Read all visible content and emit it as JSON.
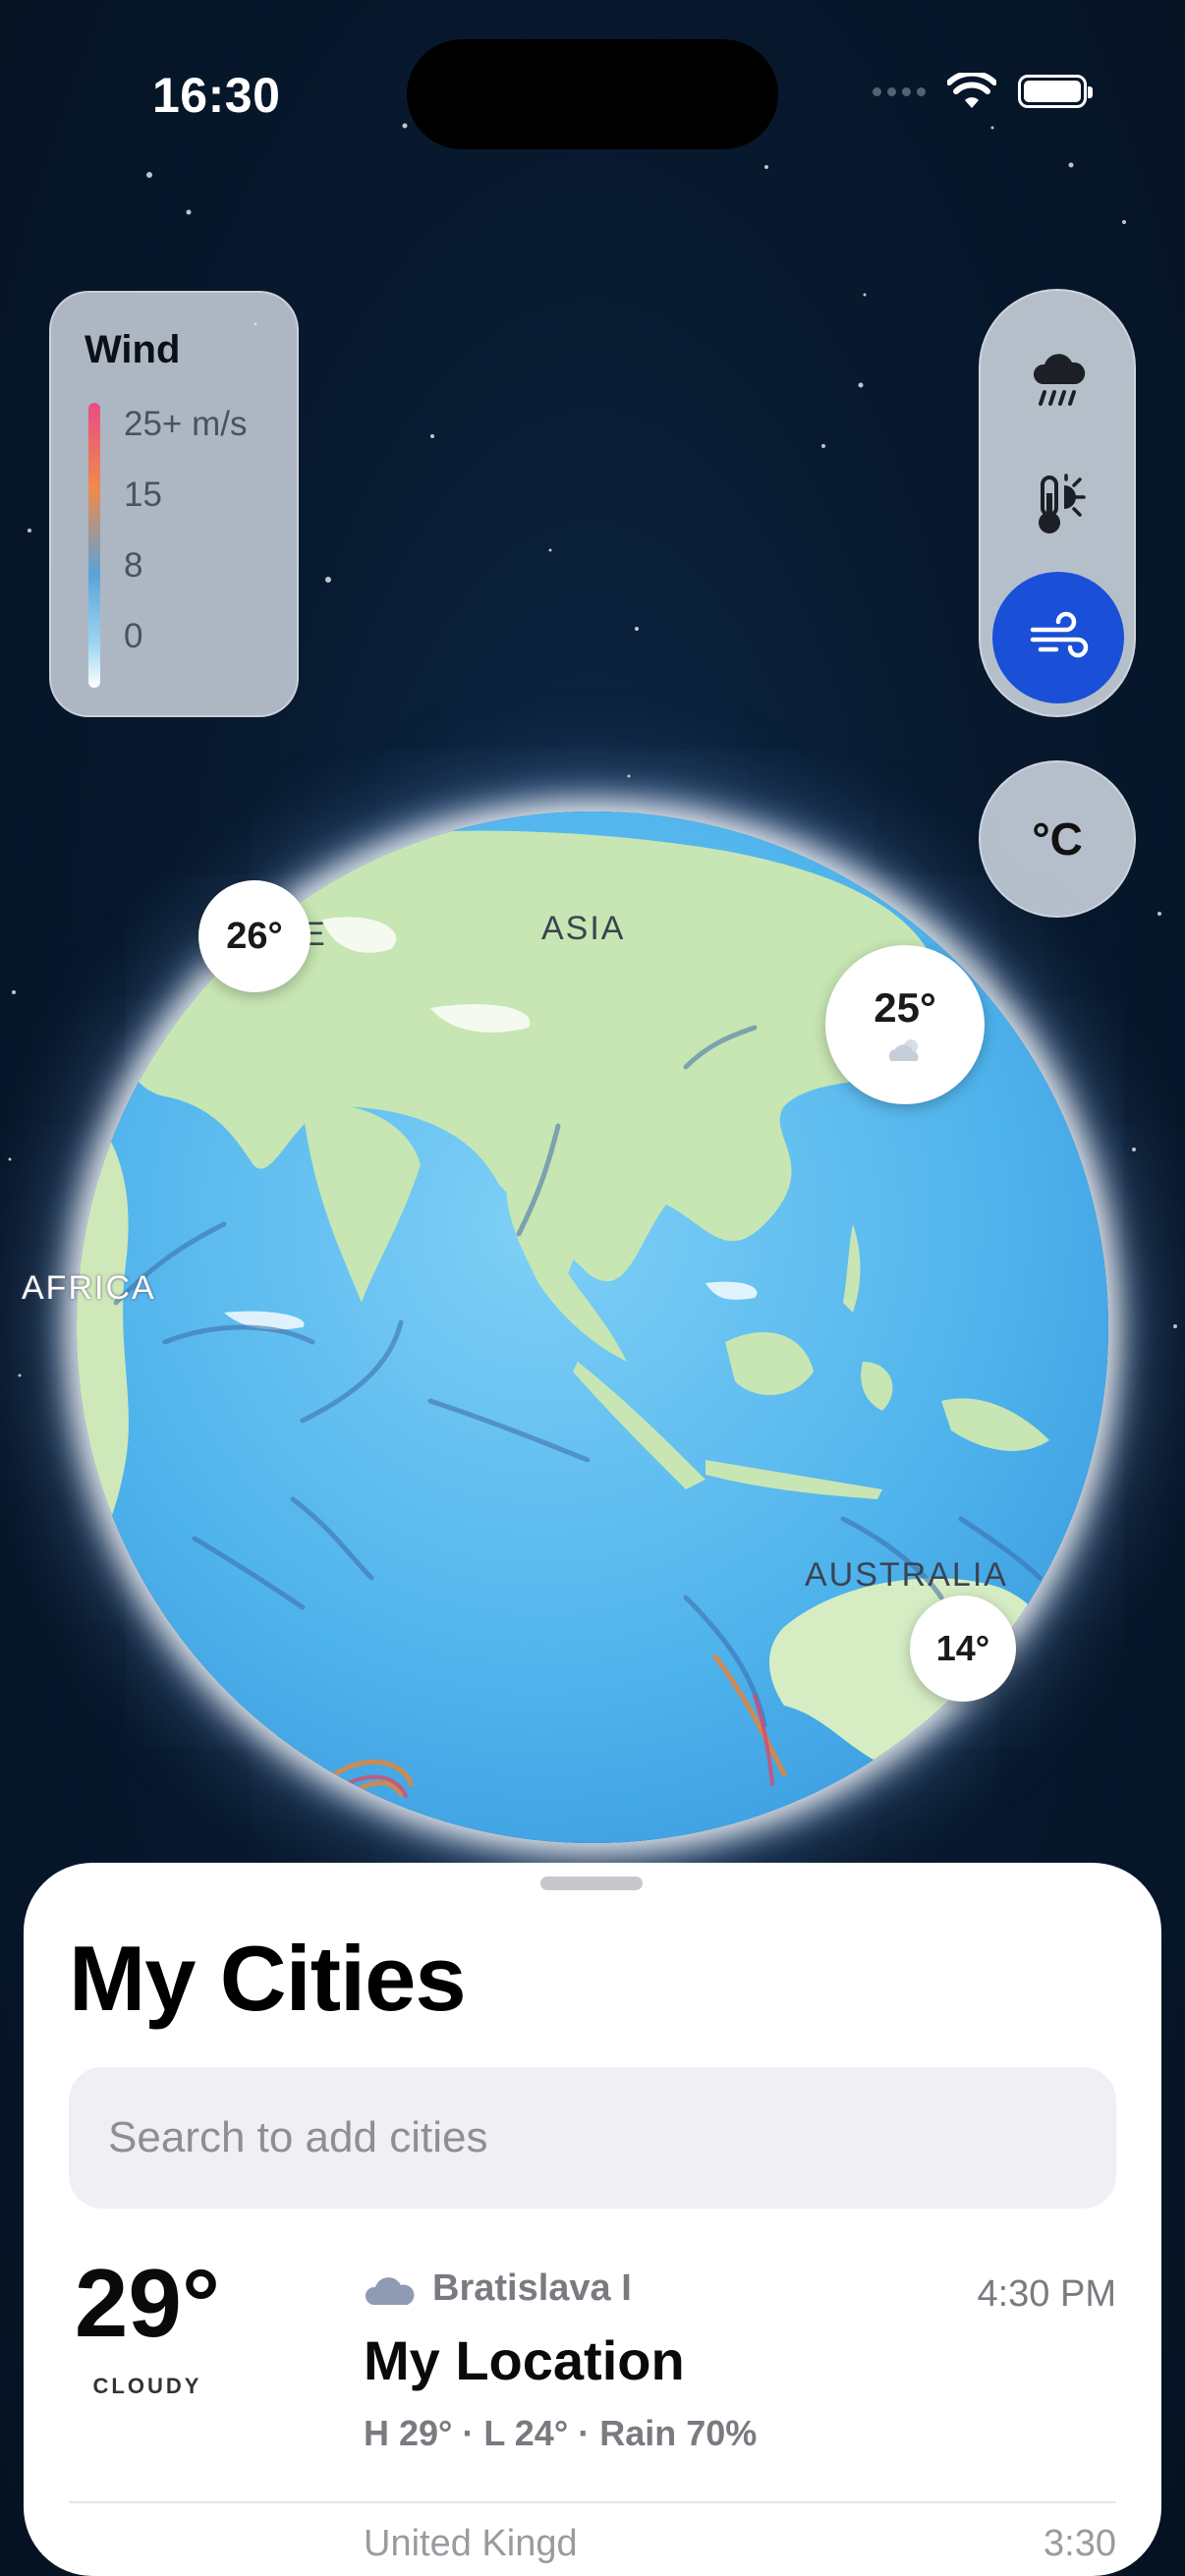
{
  "status": {
    "time": "16:30"
  },
  "legend": {
    "title": "Wind",
    "labels": [
      "25+ m/s",
      "15",
      "8",
      "0"
    ]
  },
  "layers": {
    "items": [
      {
        "name": "precipitation",
        "icon": "cloud-rain-icon",
        "active": false
      },
      {
        "name": "temperature",
        "icon": "thermometer-sun-icon",
        "active": false
      },
      {
        "name": "wind",
        "icon": "wind-icon",
        "active": true
      }
    ],
    "unit_label": "°C",
    "accent": "#1a4fd8"
  },
  "map": {
    "regions": {
      "europe_partial_left": "E",
      "europe_partial_right": "E",
      "asia": "ASIA",
      "africa": "AFRICA",
      "australia": "AUSTRALIA"
    },
    "badges": {
      "europe": "26°",
      "east_asia": "25°",
      "australia": "14°"
    }
  },
  "sheet": {
    "title": "My Cities",
    "search_placeholder": "Search to add cities",
    "cities": [
      {
        "temp": "29°",
        "condition": "CLOUDY",
        "region": "Bratislava I",
        "name": "My Location",
        "time": "4:30 PM",
        "meta": "H 29° · L 24°  ·  Rain 70%"
      }
    ],
    "next_partial": {
      "region": "United Kingd",
      "time": "3:30"
    }
  }
}
